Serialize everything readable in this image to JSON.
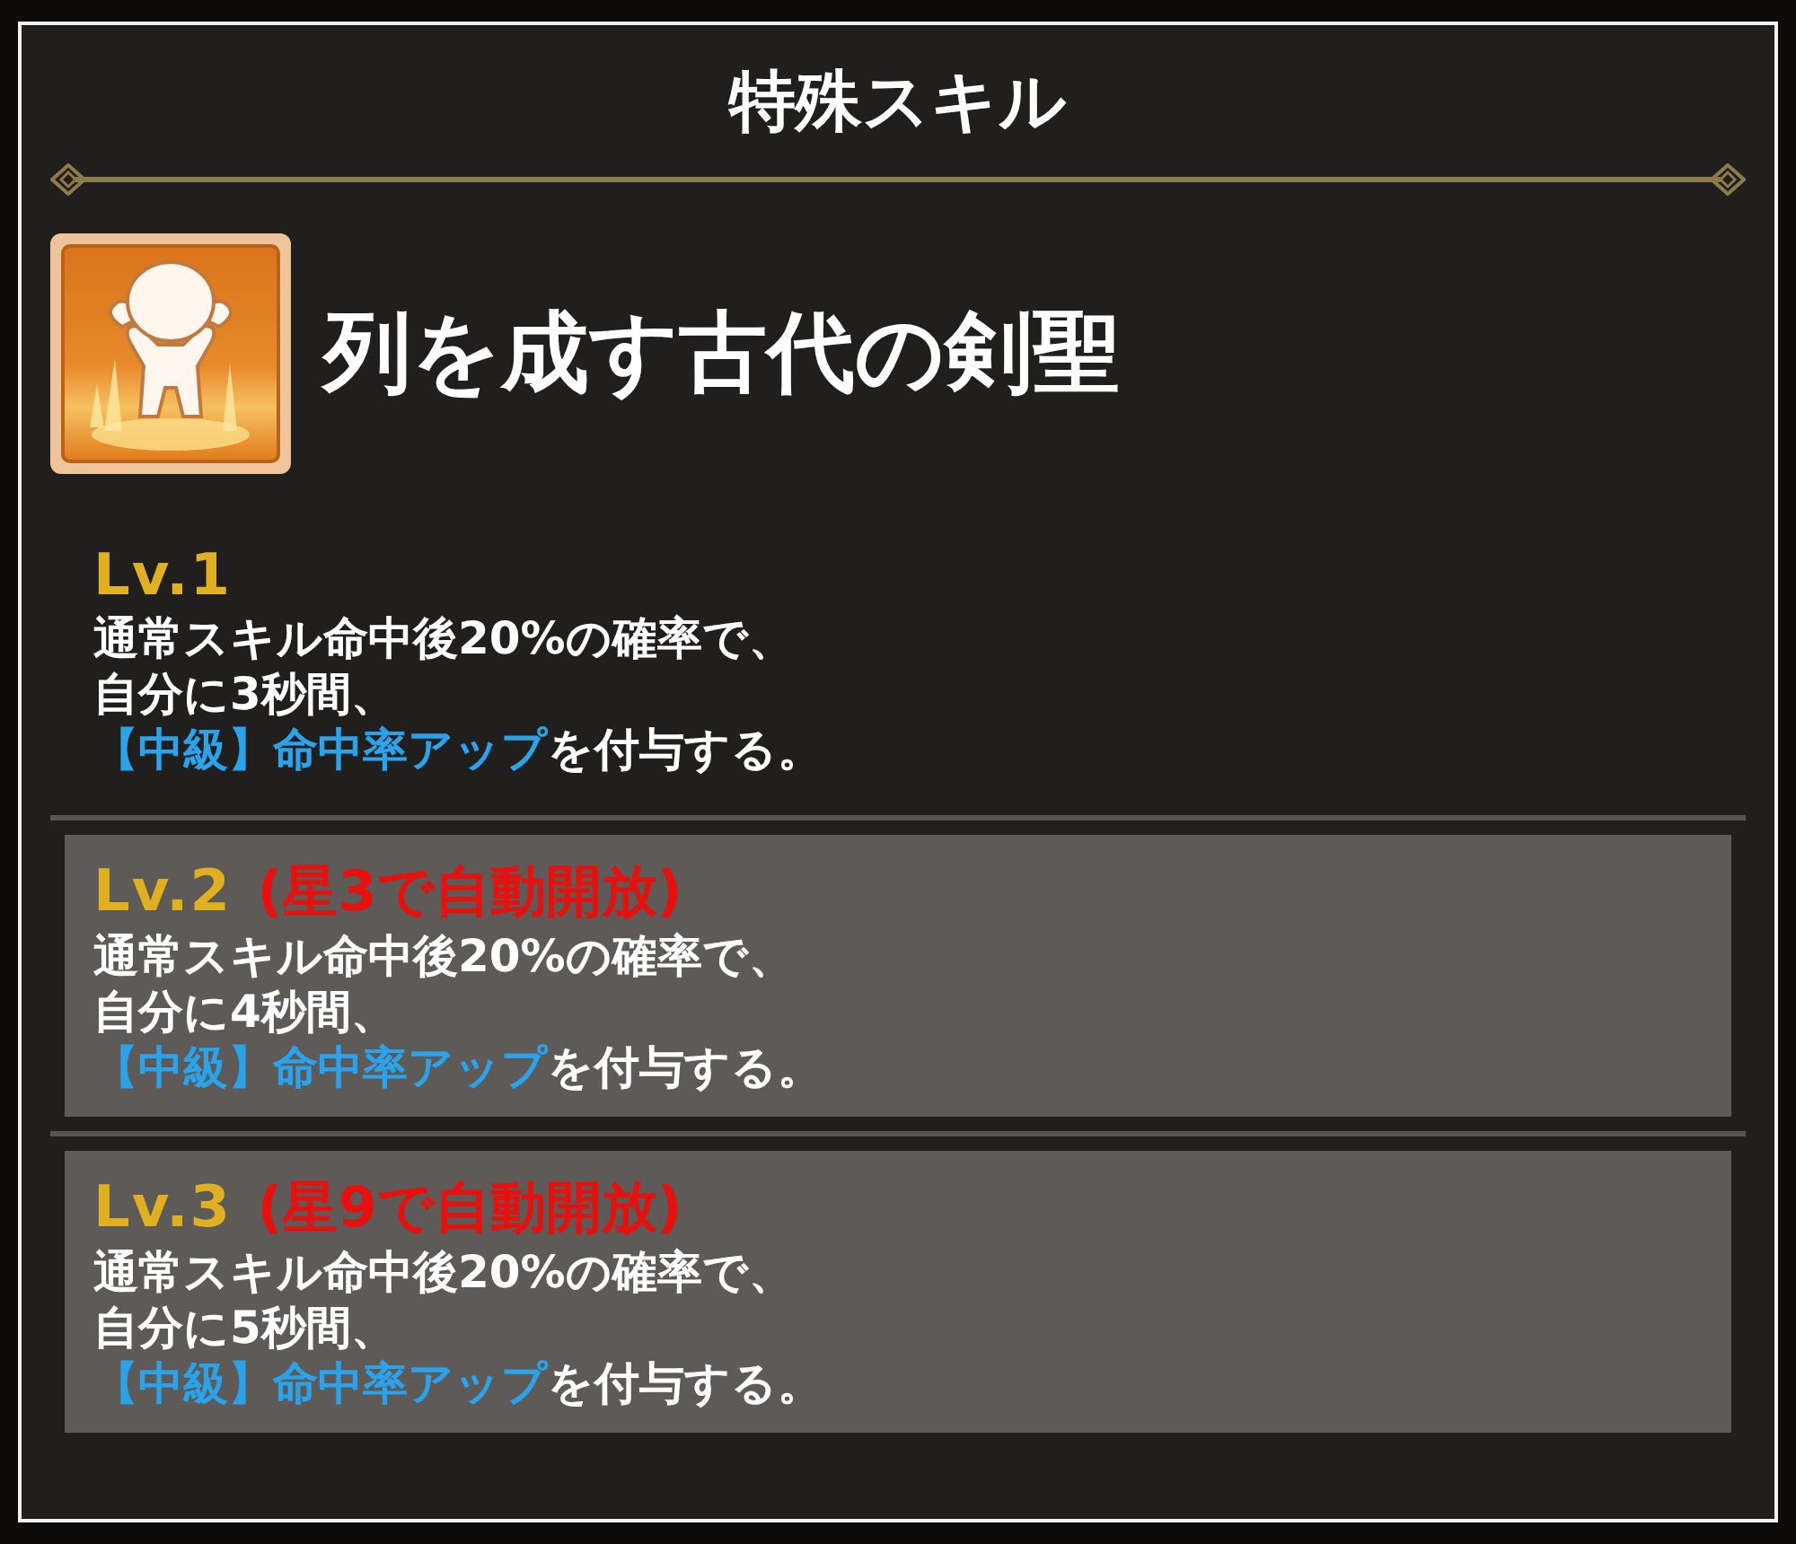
{
  "title": "特殊スキル",
  "skill": {
    "name": "列を成す古代の剣聖"
  },
  "levels": [
    {
      "label": "Lv.1",
      "locked": false,
      "description": [
        [
          {
            "text": "通常スキル命中後20%の確率で、",
            "kind": "plain"
          }
        ],
        [
          {
            "text": "自分に3秒間、",
            "kind": "plain"
          }
        ],
        [
          {
            "text": "【中級】命中率アップ",
            "kind": "keyword"
          },
          {
            "text": "を付与する。",
            "kind": "plain"
          }
        ]
      ]
    },
    {
      "label": "Lv.2",
      "locked": true,
      "unlock_note": "(星3で自動開放)",
      "description": [
        [
          {
            "text": "通常スキル命中後20%の確率で、",
            "kind": "plain"
          }
        ],
        [
          {
            "text": "自分に4秒間、",
            "kind": "plain"
          }
        ],
        [
          {
            "text": "【中級】命中率アップ",
            "kind": "keyword"
          },
          {
            "text": "を付与する。",
            "kind": "plain"
          }
        ]
      ]
    },
    {
      "label": "Lv.3",
      "locked": true,
      "unlock_note": "(星9で自動開放)",
      "description": [
        [
          {
            "text": "通常スキル命中後20%の確率で、",
            "kind": "plain"
          }
        ],
        [
          {
            "text": "自分に5秒間、",
            "kind": "plain"
          }
        ],
        [
          {
            "text": "【中級】命中率アップ",
            "kind": "keyword"
          },
          {
            "text": "を付与する。",
            "kind": "plain"
          }
        ]
      ]
    }
  ]
}
